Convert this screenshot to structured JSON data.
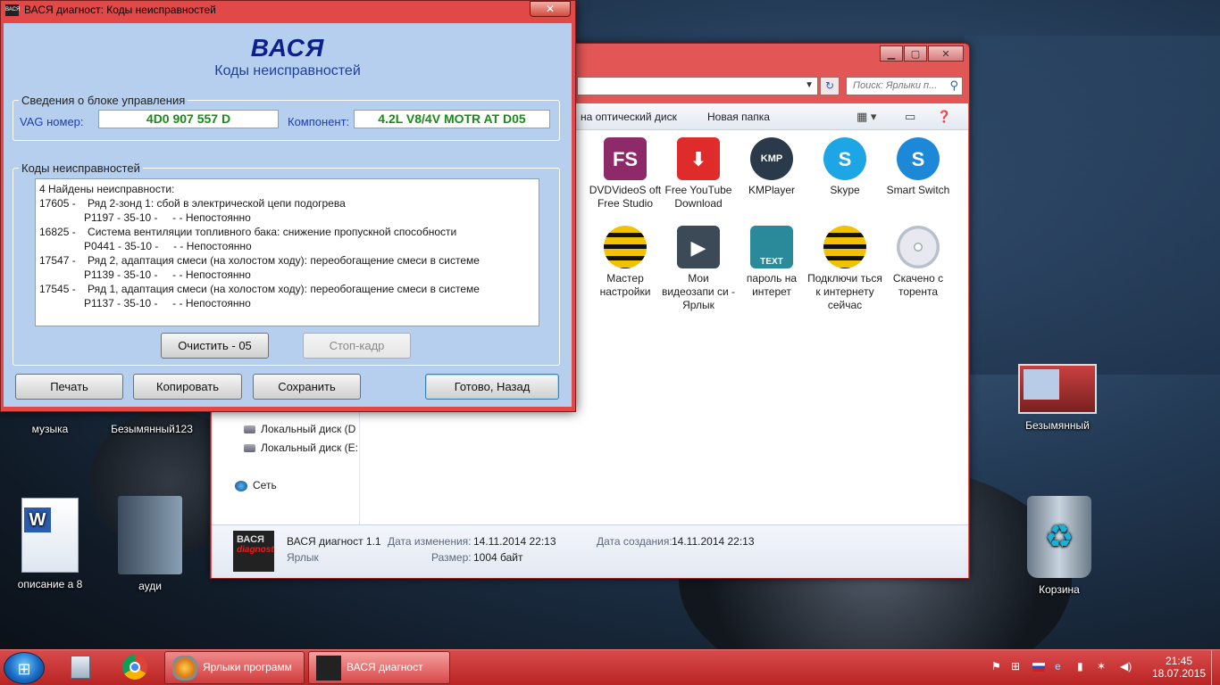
{
  "dialog": {
    "title": "ВАСЯ диагност: Коды неисправностей",
    "app_icon_text": "ВАСЯ",
    "close_label": "✕",
    "heading": "ВАСЯ",
    "subheading": "Коды неисправностей",
    "ecu_group_title": "Сведения о блоке управления",
    "vag_label": "VAG номер:",
    "vag_value": "4D0 907 557 D",
    "component_label": "Компонент:",
    "component_value": "4.2L V8/4V  MOTR AT D05",
    "faults_group_title": "Коды неисправностей",
    "faults_text": "4 Найдены неисправности:\n17605 -    Ряд 2-зонд 1: сбой в электрической цепи подогрева\n               P1197 - 35-10 -     - - Непостоянно\n16825 -    Система вентиляции топливного бака: снижение пропускной способности\n               P0441 - 35-10 -     - - Непостоянно\n17547 -    Ряд 2, адаптация смеси (на холостом ходу): переобогащение смеси в системе\n               P1139 - 35-10 -     - - Непостоянно\n17545 -    Ряд 1, адаптация смеси (на холостом ходу): переобогащение смеси в системе\n               P1137 - 35-10 -     - - Непостоянно",
    "clear_button": "Очистить - 05",
    "freeze_button": "Стоп-кадр",
    "print_button": "Печать",
    "copy_button": "Копировать",
    "save_button": "Сохранить",
    "done_button": "Готово, Назад"
  },
  "explorer": {
    "search_placeholder": "Поиск: Ярлыки п...",
    "toolbar": {
      "burn_label": "на оптический диск",
      "new_folder_label": "Новая папка"
    },
    "nav": {
      "drive_d": "Локальный диск (D",
      "drive_e": "Локальный диск (E:",
      "network": "Сеть"
    },
    "files": [
      {
        "name": "DVDVideoS oft Free Studio",
        "glyph": "FS",
        "color": "#8e2a6a"
      },
      {
        "name": "Free YouTube Download",
        "glyph": "⬇",
        "color": "#e02b2b"
      },
      {
        "name": "KMPlayer",
        "glyph": "KMP",
        "color": "#2a3a4a"
      },
      {
        "name": "Skype",
        "glyph": "S",
        "color": "#1ea5e6"
      },
      {
        "name": "Smart Switch",
        "glyph": "S",
        "color": "#1e88d8"
      },
      {
        "name": "Мастер настройки",
        "glyph": "",
        "color": "#f2c200"
      },
      {
        "name": "Мои видеозапи си - Ярлык",
        "glyph": "▶",
        "color": "#3c4a58"
      },
      {
        "name": "пароль на интерет",
        "glyph": "TEXT",
        "color": "#2a8a9a"
      },
      {
        "name": "Подключи ться к интернету сейчас",
        "glyph": "",
        "color": "#f2c200"
      },
      {
        "name": "Скачено с торента",
        "glyph": "◎",
        "color": "#c8c8c8"
      }
    ],
    "details": {
      "thumb_text": "ВАСЯ",
      "thumb_sub": "diagnost",
      "name": "ВАСЯ диагност 1.1",
      "type": "Ярлык",
      "modified_label": "Дата изменения:",
      "modified_value": "14.11.2014 22:13",
      "created_label": "Дата создания:",
      "created_value": "14.11.2014 22:13",
      "size_label": "Размер:",
      "size_value": "1004 байт"
    }
  },
  "desktop": {
    "icons": {
      "music": "музыка",
      "untitled123": "Безымянный123",
      "untitled": "Безымянный",
      "description": "описание а 8",
      "audi": "ауди",
      "recycle": "Корзина"
    }
  },
  "taskbar": {
    "task1_label": "Ярлыки программ",
    "task2_label": "ВАСЯ диагност",
    "time": "21:45",
    "date": "18.07.2015"
  },
  "colors": {
    "dialog_body": "#b6cfef",
    "window_frame": "#e34848",
    "value_text": "#1a8a1a",
    "heading": "#0d1f8a"
  }
}
